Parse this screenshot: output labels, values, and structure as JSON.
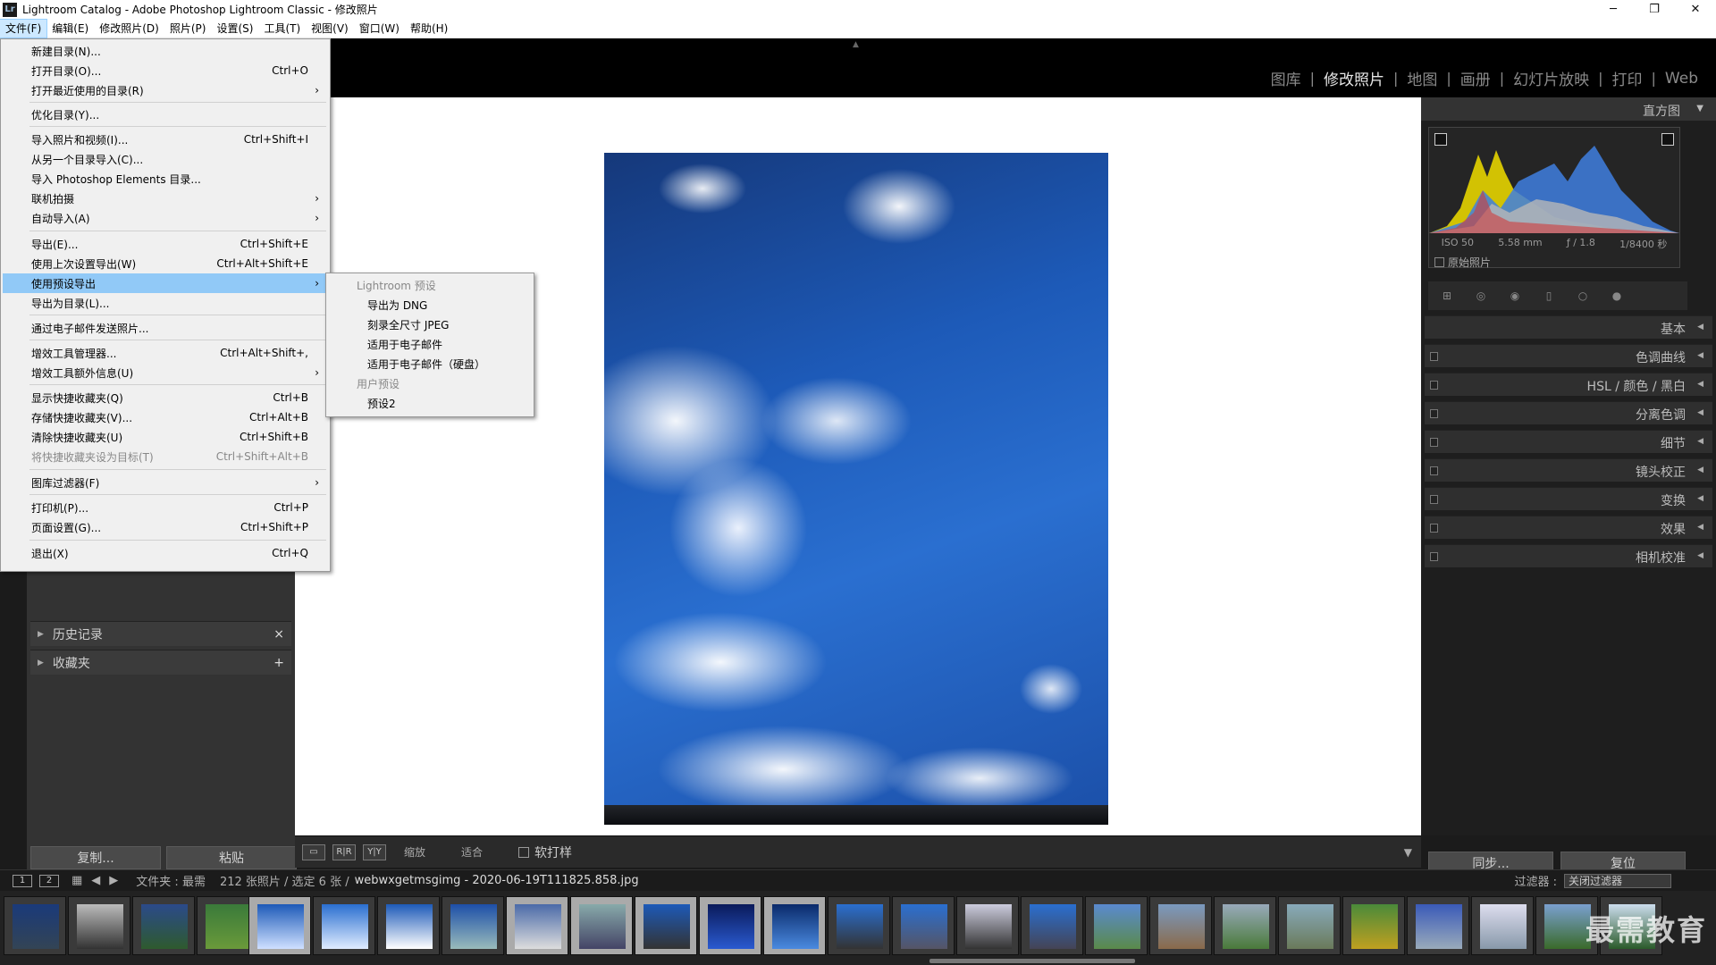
{
  "window": {
    "title": "Lightroom Catalog - Adobe Photoshop Lightroom Classic - 修改照片",
    "app_icon_text": "Lr",
    "minimize": "─",
    "maximize": "❐",
    "close": "✕"
  },
  "menubar": [
    "文件(F)",
    "编辑(E)",
    "修改照片(D)",
    "照片(P)",
    "设置(S)",
    "工具(T)",
    "视图(V)",
    "窗口(W)",
    "帮助(H)"
  ],
  "modules": [
    "图库",
    "修改照片",
    "地图",
    "画册",
    "幻灯片放映",
    "打印",
    "Web"
  ],
  "active_module": "修改照片",
  "file_menu": [
    {
      "label": "新建目录(N)...",
      "shortcut": ""
    },
    {
      "label": "打开目录(O)...",
      "shortcut": "Ctrl+O"
    },
    {
      "label": "打开最近使用的目录(R)",
      "shortcut": "",
      "submenu": true
    },
    {
      "label": "优化目录(Y)...",
      "shortcut": ""
    },
    {
      "label": "导入照片和视频(I)...",
      "shortcut": "Ctrl+Shift+I"
    },
    {
      "label": "从另一个目录导入(C)...",
      "shortcut": ""
    },
    {
      "label": "导入 Photoshop Elements 目录...",
      "shortcut": ""
    },
    {
      "label": "联机拍摄",
      "shortcut": "",
      "submenu": true
    },
    {
      "label": "自动导入(A)",
      "shortcut": "",
      "submenu": true
    },
    {
      "label": "导出(E)...",
      "shortcut": "Ctrl+Shift+E"
    },
    {
      "label": "使用上次设置导出(W)",
      "shortcut": "Ctrl+Alt+Shift+E"
    },
    {
      "label": "使用预设导出",
      "shortcut": "",
      "submenu": true,
      "highlighted": true
    },
    {
      "label": "导出为目录(L)...",
      "shortcut": ""
    },
    {
      "label": "通过电子邮件发送照片...",
      "shortcut": ""
    },
    {
      "label": "增效工具管理器...",
      "shortcut": "Ctrl+Alt+Shift+,"
    },
    {
      "label": "增效工具额外信息(U)",
      "shortcut": "",
      "submenu": true
    },
    {
      "label": "显示快捷收藏夹(Q)",
      "shortcut": "Ctrl+B"
    },
    {
      "label": "存储快捷收藏夹(V)...",
      "shortcut": "Ctrl+Alt+B"
    },
    {
      "label": "清除快捷收藏夹(U)",
      "shortcut": "Ctrl+Shift+B"
    },
    {
      "label": "将快捷收藏夹设为目标(T)",
      "shortcut": "Ctrl+Shift+Alt+B",
      "disabled": true
    },
    {
      "label": "图库过滤器(F)",
      "shortcut": "",
      "submenu": true
    },
    {
      "label": "打印机(P)...",
      "shortcut": "Ctrl+P"
    },
    {
      "label": "页面设置(G)...",
      "shortcut": "Ctrl+Shift+P"
    },
    {
      "label": "退出(X)",
      "shortcut": "Ctrl+Q"
    }
  ],
  "export_submenu": [
    {
      "label": "Lightroom 预设",
      "header": true
    },
    {
      "label": "导出为 DNG"
    },
    {
      "label": "刻录全尺寸 JPEG"
    },
    {
      "label": "适用于电子邮件"
    },
    {
      "label": "适用于电子邮件（硬盘）"
    },
    {
      "label": "用户预设",
      "header": true
    },
    {
      "label": "预设2"
    }
  ],
  "left_panel": {
    "history": "历史记录",
    "history_icon": "×",
    "collections": "收藏夹",
    "collections_icon": "+",
    "copy": "复制...",
    "paste": "粘贴"
  },
  "right_panel": {
    "histogram_title": "直方图",
    "exif": {
      "iso": "ISO 50",
      "focal": "5.58 mm",
      "aperture": "ƒ / 1.8",
      "shutter": "1/8400 秒"
    },
    "original_photo": "原始照片",
    "sections": [
      "基本",
      "色调曲线",
      "HSL / 颜色 / 黑白",
      "分离色调",
      "细节",
      "镜头校正",
      "变换",
      "效果",
      "相机校准"
    ],
    "sync": "同步...",
    "reset": "复位"
  },
  "toolbar": {
    "zoom_label": "缩放",
    "fit_label": "适合",
    "softproof": "软打样",
    "view_rr": "R|R",
    "view_yy": "Y|Y"
  },
  "filmstrip_bar": {
    "view1": "1",
    "view2": "2",
    "source": "文件夹 : 最需",
    "count": "212 张照片 / 选定 6 张 /",
    "filename": "webwxgetmsgimg - 2020-06-19T111825.858.jpg",
    "filter_label": "过滤器 :",
    "filter_value": "关闭过滤器"
  },
  "watermark": "最需教育",
  "colors": {
    "accent_highlight": "#91c9f7",
    "panel_bg": "#333333",
    "sky_blue": "#1d5ab8"
  }
}
